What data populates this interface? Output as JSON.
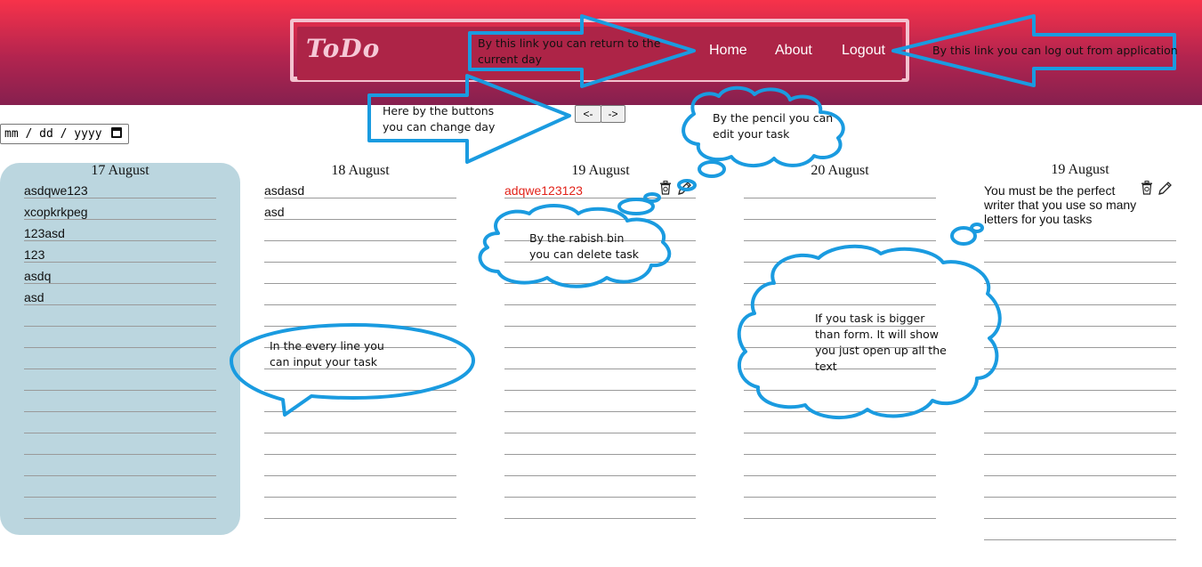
{
  "header": {
    "logo": "ToDo",
    "nav": {
      "home": "Home",
      "about": "About",
      "logout": "Logout"
    }
  },
  "date_input": {
    "placeholder": "mm / dd / yyyy"
  },
  "pager": {
    "prev": "<-",
    "next": "->"
  },
  "columns": [
    {
      "date": "17 August",
      "tasks": [
        "asdqwe123",
        "xcopkrkpeg",
        "123asd",
        "123",
        "asdq",
        "asd"
      ]
    },
    {
      "date": "18 August",
      "tasks": [
        "asdasd",
        "asd"
      ]
    },
    {
      "date": "19 August",
      "tasks": [
        "adqwe123123"
      ]
    },
    {
      "date": "20 August",
      "tasks": []
    },
    {
      "date": "19 August",
      "tasks": [
        "You must be the perfect writer that you use so many letters for you tasks"
      ]
    }
  ],
  "annotations": {
    "home_link": "By this link you can return to the current day",
    "logout_link": "By this link you can log out from application",
    "change_day": "Here by the buttons you can change day",
    "pencil": "By the pencil you can edit your task",
    "bin": "By the rabish bin you can delete task",
    "line_input": "In the every line you can input your task",
    "long_task": "If you task is bigger than form. It will show you just open up all the text"
  },
  "colors": {
    "header_top": "#f7324a",
    "header_bottom": "#86204f",
    "annotation": "#1a9be0",
    "active_column": "#bbd6df",
    "highlight_task": "#e2231a"
  }
}
